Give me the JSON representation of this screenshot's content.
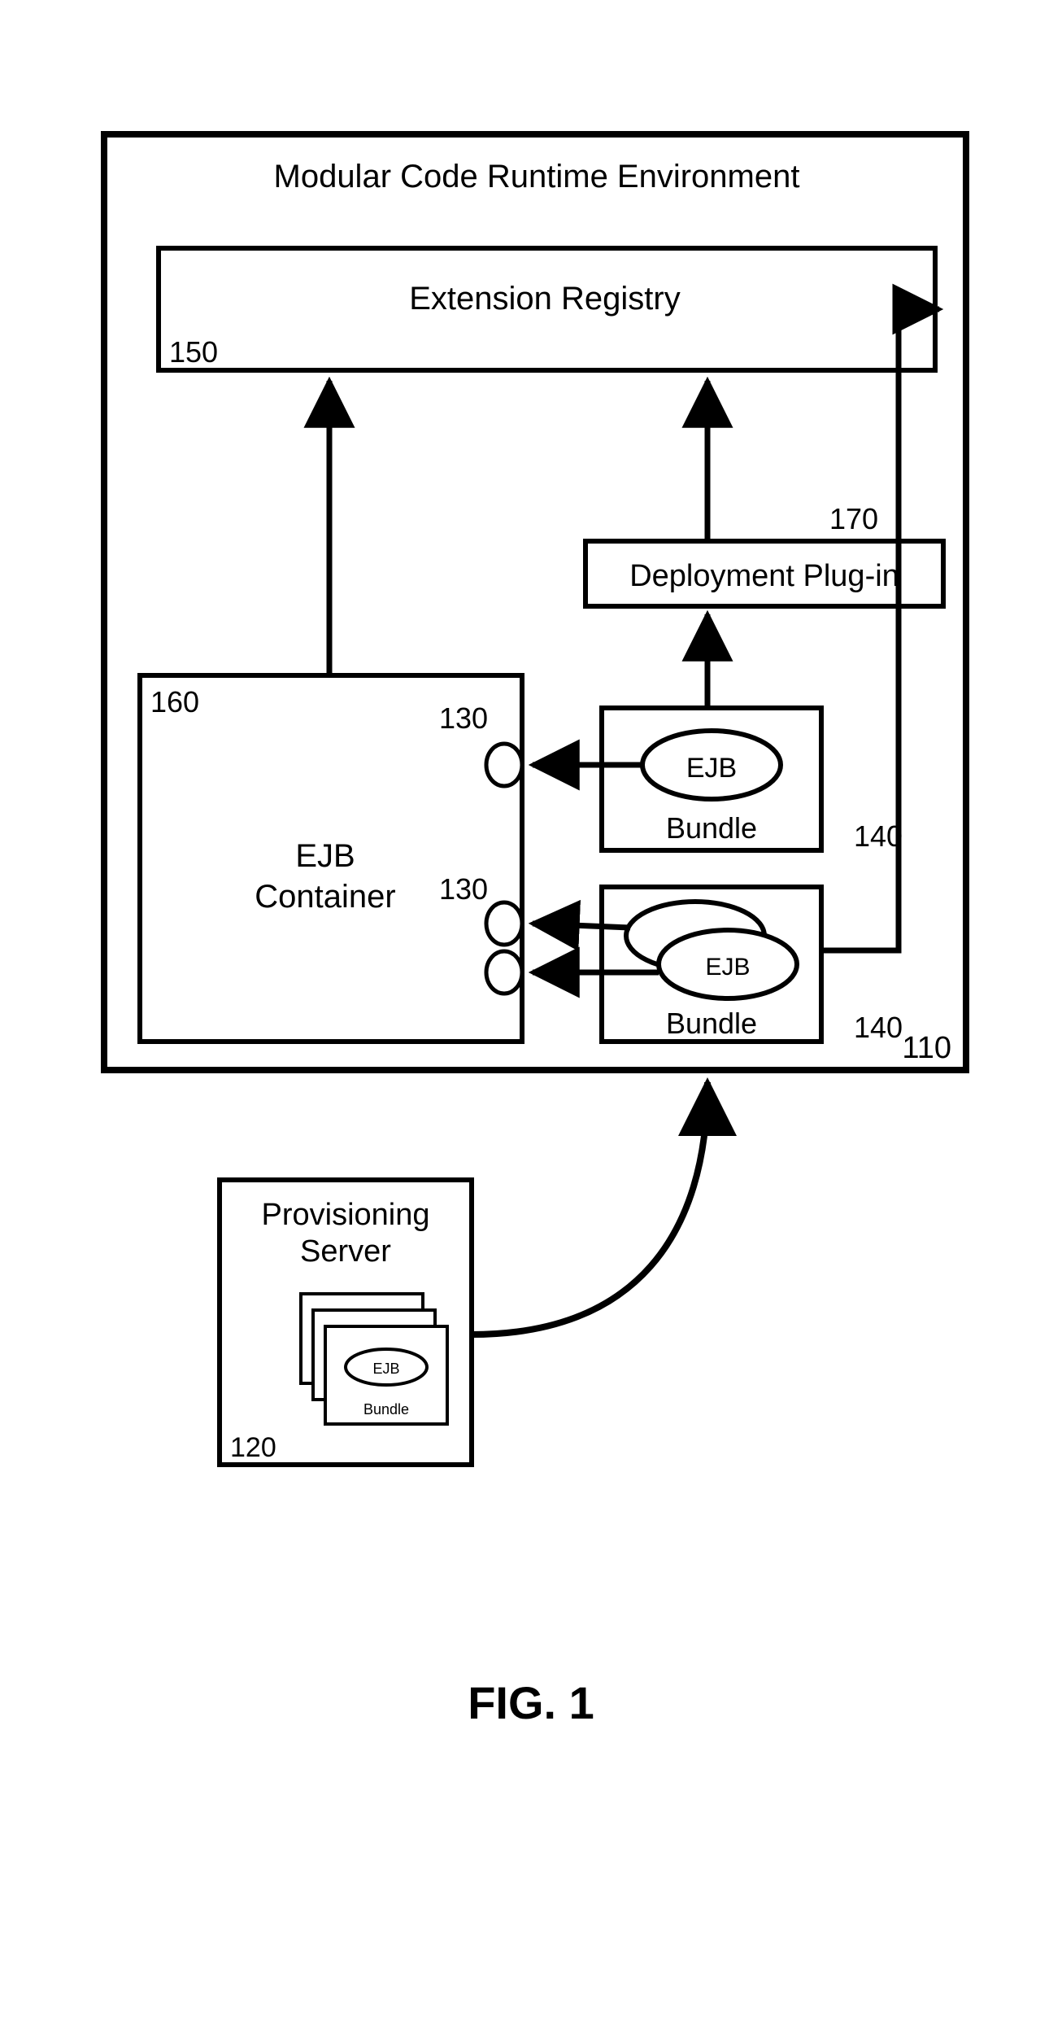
{
  "figure_label": "FIG. 1",
  "env": {
    "title": "Modular Code Runtime Environment",
    "ref": "110"
  },
  "extension_registry": {
    "title": "Extension Registry",
    "ref": "150"
  },
  "deployment_plugin": {
    "title": "Deployment Plug-in",
    "ref": "170"
  },
  "ejb_container": {
    "title_line1": "EJB",
    "title_line2": "Container",
    "ref": "160",
    "socket_ref_1": "130",
    "socket_ref_2": "130"
  },
  "bundle_top": {
    "title": "Bundle",
    "ejb_label": "EJB",
    "ref": "140"
  },
  "bundle_bottom": {
    "title": "Bundle",
    "ejb_label": "EJB",
    "ref": "140"
  },
  "provisioning_server": {
    "title_line1": "Provisioning",
    "title_line2": "Server",
    "ref": "120",
    "card_ejb": "EJB",
    "card_bundle": "Bundle"
  }
}
